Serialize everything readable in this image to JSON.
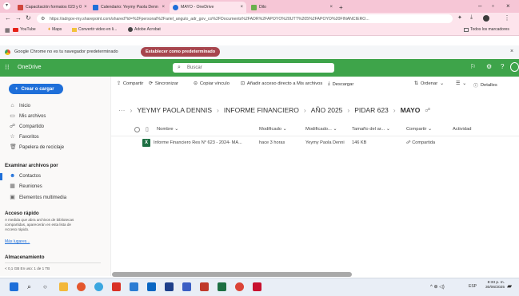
{
  "browser": {
    "tabs": [
      {
        "label": "Capacitación formatos 023 y 0"
      },
      {
        "label": "Calendario: Yeymy Paola Denn"
      },
      {
        "label": "MAYO - OneDrive"
      },
      {
        "label": "Dilo"
      },
      {
        "label": ""
      }
    ],
    "url": "https://adrgov-my.sharepoint.com/shared?id=%2Fpersonal%2Fariel_angulo_adr_gov_co%2FDocuments%2FADR%2FAPOYO%20UTT%205%2FAPOYO%20FINANCIERO...",
    "bookmarks": [
      {
        "label": "YouTube"
      },
      {
        "label": "Maps"
      },
      {
        "label": "Convertir video en li..."
      },
      {
        "label": "Adobe Acrobat"
      }
    ],
    "all_bookmarks_label": "Todos los marcadores",
    "infobar_text": "Google Chrome no es tu navegador predeterminado",
    "infobar_button": "Establecer como predeterminado"
  },
  "onedrive": {
    "app_name": "OneDrive",
    "search_placeholder": "Buscar"
  },
  "sidebar": {
    "create_button": "Crear o cargar",
    "nav": [
      {
        "label": "Inicio",
        "icon": "home-icon"
      },
      {
        "label": "Mis archivos",
        "icon": "folder-icon"
      },
      {
        "label": "Compartido",
        "icon": "people-icon"
      },
      {
        "label": "Favoritos",
        "icon": "star-icon"
      },
      {
        "label": "Papelera de reciclaje",
        "icon": "trash-icon"
      }
    ],
    "browse_header": "Examinar archivos por",
    "browse": [
      {
        "label": "Contactos",
        "icon": "person-icon"
      },
      {
        "label": "Reuniones",
        "icon": "calendar-icon"
      },
      {
        "label": "Elementos multimedia",
        "icon": "media-icon"
      }
    ],
    "quick_header": "Acceso rápido",
    "quick_text": "A medida que abra archivos de bibliotecas compartidas, aparecerán en esta lista de Acceso rápido.",
    "quick_link": "Más lugares...",
    "storage_header": "Almacenamiento",
    "storage_text": "< 0,1 GB En uso: 1 de 1 TB"
  },
  "commandbar": {
    "share": "Compartir",
    "sync": "Sincronizar",
    "copy_link": "Copiar vínculo",
    "add_shortcut": "Añadir acceso directo a Mis archivos",
    "download": "Descargar",
    "sort": "Ordenar",
    "details": "Detalles"
  },
  "breadcrumb": {
    "ellipsis": "···",
    "items": [
      "YEYMY PAOLA DENNIS",
      "INFORME FINANCIERO",
      "AÑO 2025",
      "PIDAR 623",
      "MAYO"
    ]
  },
  "table": {
    "columns": [
      "Nombre",
      "Modificado",
      "Modificado...",
      "Tamaño del ar...",
      "Compartir",
      "Actividad"
    ],
    "rows": [
      {
        "name": "Informe Financiero Res N° 623 - 2024- MA...",
        "modified": "hace 3 horas",
        "modified_by": "Yeymy Paola Denni",
        "size": "146 KB",
        "sharing": "Compartida"
      }
    ]
  },
  "taskbar": {
    "lang": "ESP",
    "time": "8:33 p. m.",
    "date": "30/06/2025"
  }
}
